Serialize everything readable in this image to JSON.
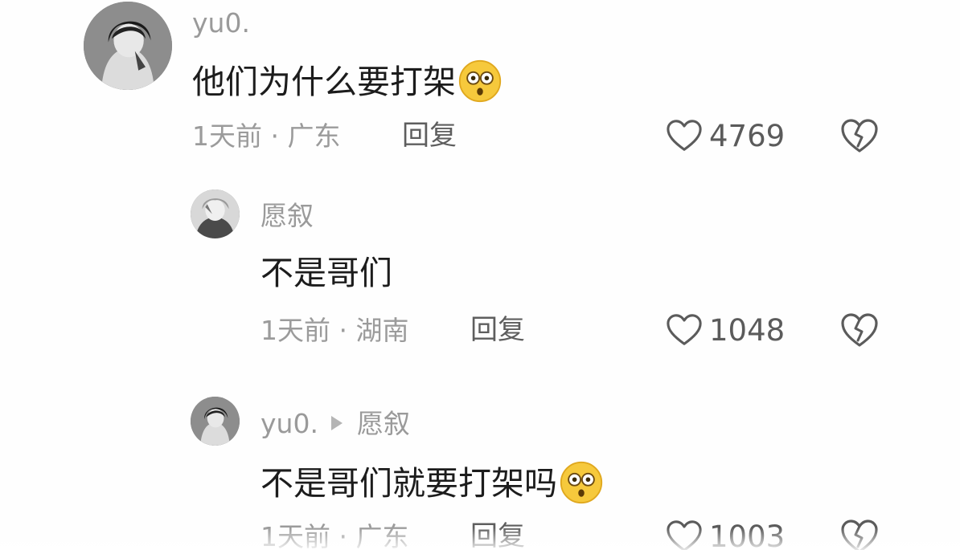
{
  "comments": [
    {
      "username": "yu0.",
      "text": "他们为什么要打架",
      "emoji": "astonished-emoji",
      "time": "1天前",
      "separator": "·",
      "location": "广东",
      "reply_label": "回复",
      "likes": "4769"
    },
    {
      "username": "愿叙",
      "text": "不是哥们",
      "time": "1天前",
      "separator": "·",
      "location": "湖南",
      "reply_label": "回复",
      "likes": "1048"
    },
    {
      "username": "yu0.",
      "reply_to": "愿叙",
      "text": "不是哥们就要打架吗",
      "emoji": "astonished-emoji",
      "time": "1天前",
      "separator": "·",
      "location": "广东",
      "reply_label": "回复",
      "likes": "1003"
    }
  ],
  "icons": {
    "like": "heart-outline-icon",
    "dislike": "broken-heart-outline-icon"
  },
  "colors": {
    "username": "#9a9a9a",
    "text": "#1c1c1c",
    "meta": "#9b9b9b",
    "reply": "#5e5e5e",
    "icon": "#5b5b5b",
    "emoji_face": "#f6c93c"
  }
}
